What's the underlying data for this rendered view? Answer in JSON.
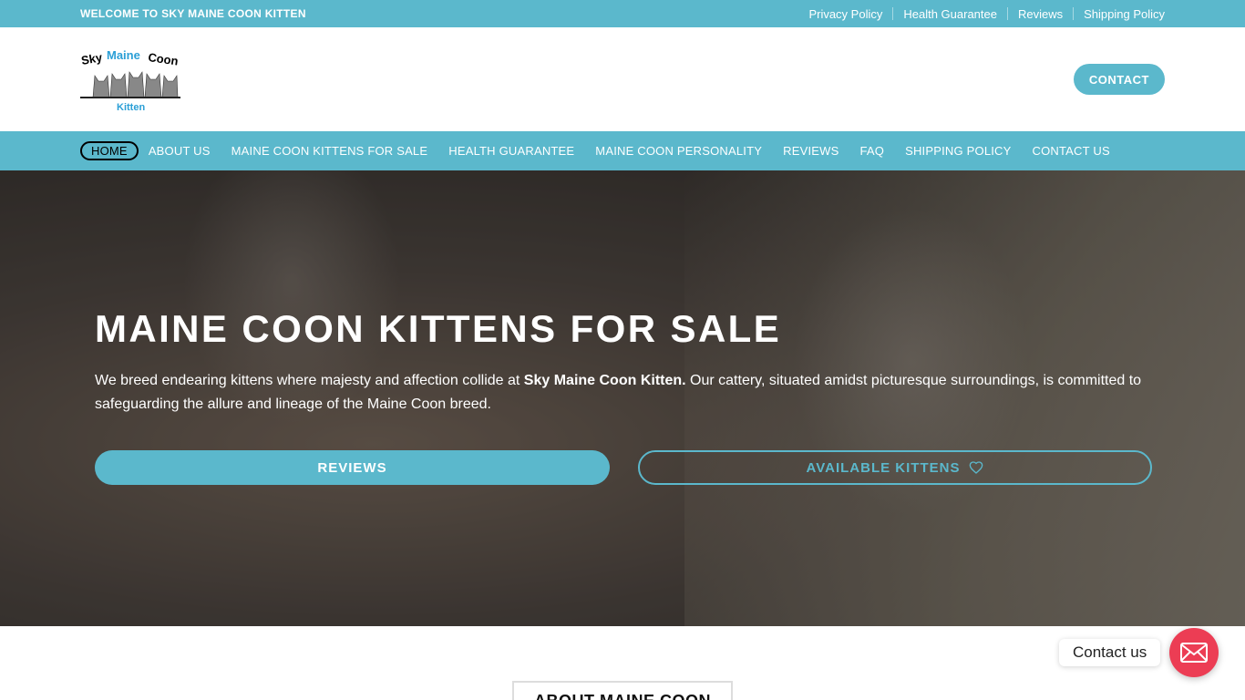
{
  "topbar": {
    "welcome": "WELCOME TO SKY MAINE COON KITTEN",
    "links": [
      "Privacy Policy",
      "Health Guarantee",
      "Reviews",
      "Shipping Policy"
    ]
  },
  "header": {
    "logo": {
      "line1": "Sky Maine Coon",
      "line2": "Kitten"
    },
    "contact_button": "CONTACT"
  },
  "nav": {
    "items": [
      "HOME",
      "ABOUT US",
      "MAINE COON KITTENS FOR SALE",
      "HEALTH GUARANTEE",
      "MAINE COON PERSONALITY",
      "REVIEWS",
      "FAQ",
      "SHIPPING POLICY",
      "CONTACT US"
    ],
    "active": "HOME"
  },
  "hero": {
    "title": "MAINE COON KITTENS FOR SALE",
    "text_before": "We breed endearing kittens where majesty and affection collide at ",
    "text_bold": "Sky Maine Coon Kitten.",
    "text_after": " Our cattery, situated amidst picturesque surroundings, is committed to safeguarding the allure and lineage of the Maine Coon breed.",
    "btn_reviews": "REVIEWS",
    "btn_kittens": "AVAILABLE KITTENS"
  },
  "about": {
    "heading": "ABOUT MAINE COON"
  },
  "floating": {
    "label": "Contact us",
    "icon": "envelope-icon"
  },
  "colors": {
    "accent": "#5bb8cc",
    "float": "#ec3d54"
  }
}
